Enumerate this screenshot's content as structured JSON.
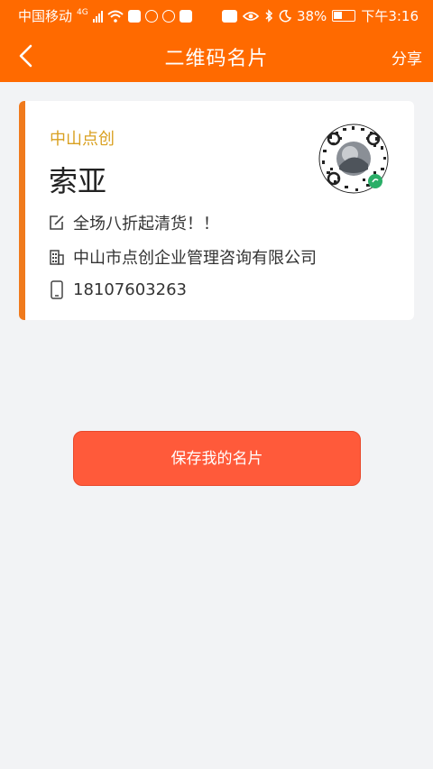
{
  "status_bar": {
    "carrier": "中国移动",
    "network": "4G",
    "battery": "38%",
    "time": "下午3:16"
  },
  "navbar": {
    "title": "二维码名片",
    "share_label": "分享"
  },
  "card": {
    "company_short": "中山点创",
    "name": "索亚",
    "slogan": "全场八折起清货！！",
    "company_full": "中山市点创企业管理咨询有限公司",
    "phone": "18107603263"
  },
  "save_button_label": "保存我的名片",
  "colors": {
    "brand": "#ff6a00",
    "accent_bar": "#f07a1c",
    "company_label": "#d9a020",
    "button": "#ff5a3a",
    "background": "#f2f3f5"
  },
  "icons": [
    "back-arrow-icon",
    "edit-icon",
    "building-icon",
    "phone-icon",
    "mini-program-qr-icon"
  ]
}
